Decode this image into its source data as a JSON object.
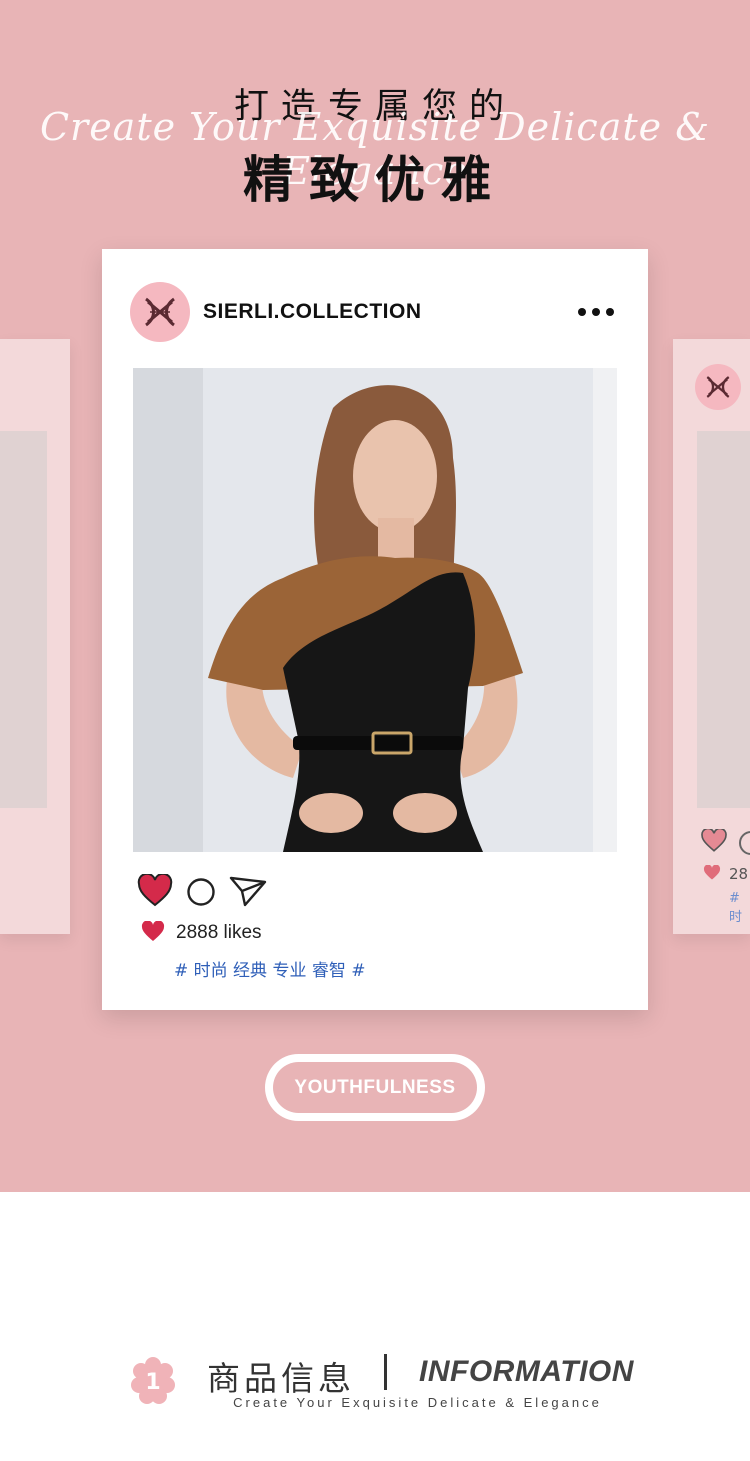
{
  "headline": {
    "line1": "打造专属您的",
    "script": "Create Your Exquisite Delicate & Elegance",
    "line2": "精致优雅"
  },
  "post": {
    "username": "SIERLI.COLLECTION",
    "likes": "2888 likes",
    "tags": "# 时尚 经典 专业 睿智 #",
    "icons": [
      "logo-icon",
      "more-icon",
      "heart-icon",
      "comment-icon",
      "send-icon"
    ],
    "heart_color": "#d42a4a"
  },
  "side_card": {
    "likes_partial": "28",
    "tag_partial": "# 时"
  },
  "badge": {
    "label": "YOUTHFULNESS"
  },
  "info_section": {
    "number": "1",
    "title_cn": "商品信息",
    "title_en": "INFORMATION",
    "subtitle": "Create Your Exquisite Delicate & Elegance"
  },
  "colors": {
    "background_pink": "#e8b4b6",
    "card_pink": "#f3d9da",
    "logo_pink": "#f5b8c0",
    "tag_blue": "#2f5fb8"
  }
}
